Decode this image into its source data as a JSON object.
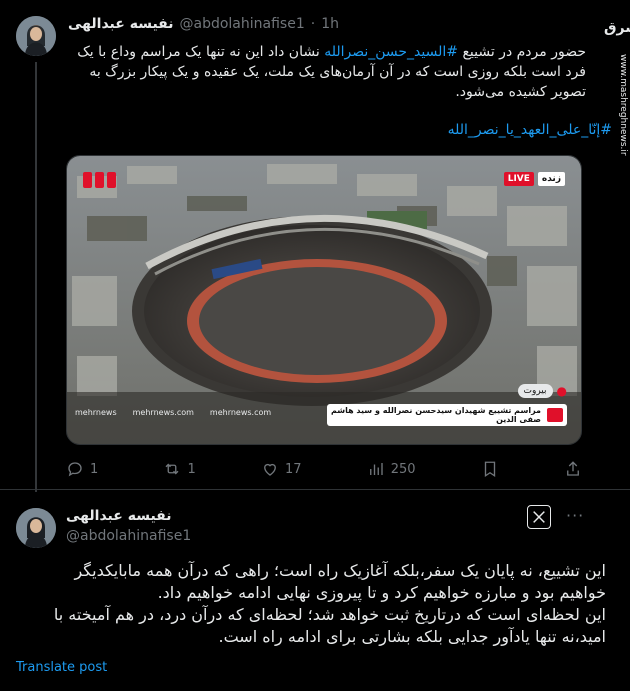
{
  "tweet1": {
    "author_name": "نفیسه عبدالهی",
    "author_handle": "@abdolahinafise1",
    "sep": "·",
    "time": "1h",
    "text_before": "حضور مردم در تشییع ",
    "hashtag1": "#السید_حسن_نصرالله",
    "text_after": " نشان داد این نه تنها یک مراسم وداع با یک فرد است بلکه روزی است که در آن آرمان‌های یک ملت، یک عقیده و یک پیکار بزرگ به تصویر کشیده می‌شود.",
    "hashtag2": "#إنّا_علی_العهد_یا_نصر_الله",
    "media": {
      "live_label": "LIVE",
      "live_fa": "زنده",
      "location": "بیروت",
      "caption": "مراسم تشییع شهیدان سیدحسن نصرالله و سید هاشم صفی الدین",
      "site": "mehrnews.com",
      "brand": "mehrnews"
    },
    "actions": {
      "reply_count": "1",
      "retweet_count": "1",
      "like_count": "17",
      "view_count": "250"
    }
  },
  "tweet2": {
    "author_name": "نفیسه عبدالهی",
    "author_handle": "@abdolahinafise1",
    "more": "···",
    "line1": "این تشییع، نه پایان یک سفر،بلکه آغازیک راه است؛ راهی که درآن همه مابایکدیگر",
    "line2": "خواهیم بود و مبارزه خواهیم کرد و تا پیروزی نهایی ادامه خواهیم داد.",
    "line3": "این لحظه‌ای است که درتاریخ ثبت خواهد شد؛ لحظه‌ای که درآن درد، در هم آمیخته با",
    "line4": "امید،نه تنها یادآور جدایی بلکه بشارتی برای ادامه راه است.",
    "translate": "Translate post"
  },
  "watermark": {
    "brand": "مشرق",
    "url": "www.mashreghnews.ir"
  },
  "colors": {
    "background": "#000000",
    "text": "#e7e9ea",
    "muted": "#71767b",
    "link": "#1d9bf0",
    "border": "#2f3336",
    "live_red": "#e0102a"
  }
}
